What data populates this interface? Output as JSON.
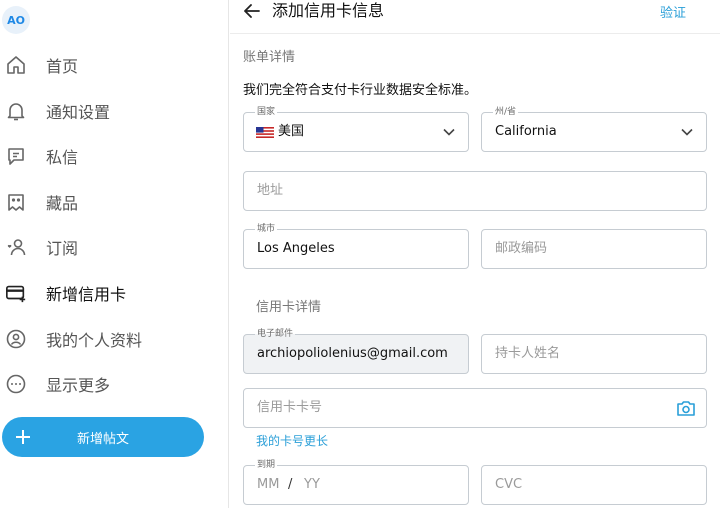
{
  "sidebar": {
    "avatar": "AO",
    "items": [
      {
        "label": "首页",
        "icon": "home-icon"
      },
      {
        "label": "通知设置",
        "icon": "bell-icon"
      },
      {
        "label": "私信",
        "icon": "message-icon"
      },
      {
        "label": "藏品",
        "icon": "collection-icon"
      },
      {
        "label": "订阅",
        "icon": "subscriptions-icon"
      },
      {
        "label": "新增信用卡",
        "icon": "credit-card-add-icon"
      },
      {
        "label": "我的个人资料",
        "icon": "profile-icon"
      },
      {
        "label": "显示更多",
        "icon": "more-icon"
      }
    ],
    "new_post": "新增帖文"
  },
  "header": {
    "title": "添加信用卡信息",
    "verify": "验证"
  },
  "form": {
    "billing_title": "账单详情",
    "security_note": "我们完全符合支付卡行业数据安全标准。",
    "country": {
      "label": "国家",
      "value": "美国"
    },
    "state": {
      "label": "州/省",
      "value": "California"
    },
    "address": {
      "placeholder": "地址"
    },
    "city": {
      "label": "城市",
      "value": "Los Angeles"
    },
    "zip": {
      "placeholder": "邮政编码"
    },
    "card_title": "信用卡详情",
    "email": {
      "label": "电子邮件",
      "value": "archiopoliolenius@gmail.com"
    },
    "holder": {
      "placeholder": "持卡人姓名"
    },
    "card_number": {
      "placeholder": "信用卡卡号"
    },
    "longer_link": "我的卡号更长",
    "expiry": {
      "label": "到期",
      "mm": "MM",
      "sep": "/",
      "yy": "YY"
    },
    "cvc": {
      "placeholder": "CVC"
    }
  },
  "colors": {
    "accent": "#2aa3e3",
    "link": "#2a9fd8",
    "border": "#c6ccd2"
  }
}
